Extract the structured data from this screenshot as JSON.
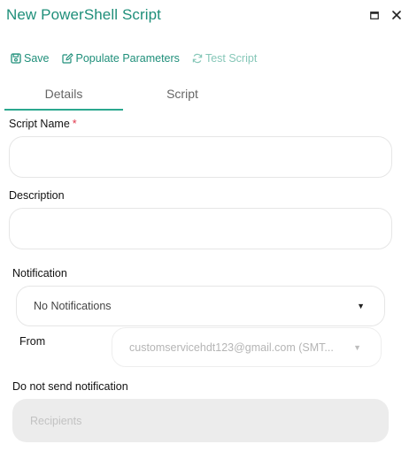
{
  "window": {
    "title": "New PowerShell Script"
  },
  "toolbar": {
    "save_label": "Save",
    "populate_label": "Populate Parameters",
    "test_label": "Test Script"
  },
  "tabs": [
    {
      "label": "Details",
      "active": true
    },
    {
      "label": "Script",
      "active": false
    }
  ],
  "form": {
    "script_name": {
      "label": "Script Name",
      "required_mark": "*",
      "value": ""
    },
    "description": {
      "label": "Description",
      "value": ""
    },
    "notification": {
      "label": "Notification",
      "selected": "No Notifications"
    },
    "from": {
      "label": "From",
      "selected": "customservicehdt123@gmail.com (SMT..."
    },
    "do_not_send": {
      "label": "Do not send notification"
    },
    "recipients": {
      "placeholder": "Recipients"
    }
  },
  "colors": {
    "accent": "#1f8f7a",
    "accent_light": "#86c7b8",
    "tab_underline": "#2aa88f",
    "required": "#e0364c"
  }
}
